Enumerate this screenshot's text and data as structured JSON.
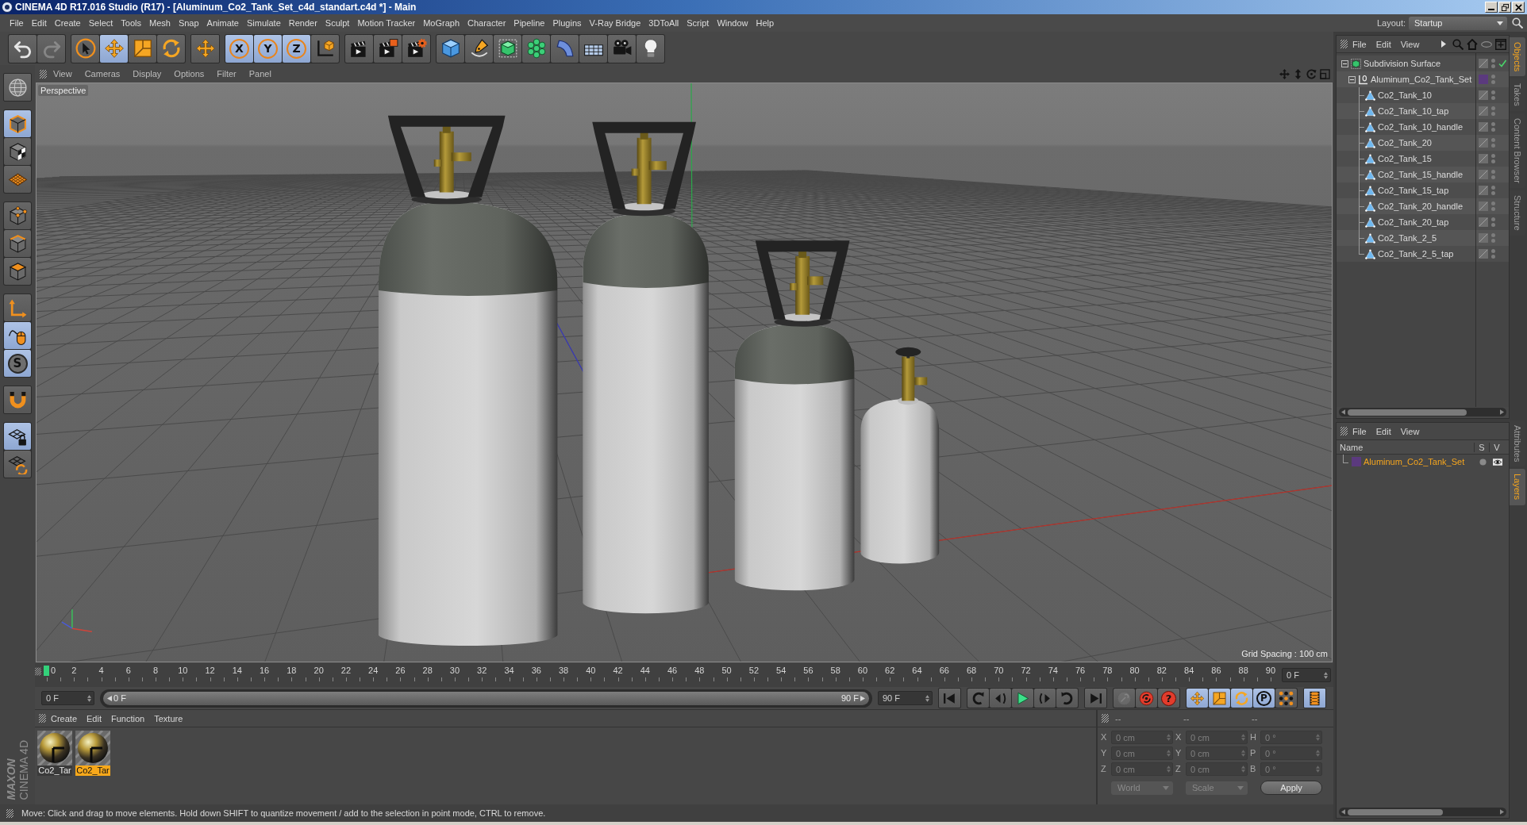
{
  "window": {
    "title": "CINEMA 4D R17.016 Studio (R17) - [Aluminum_Co2_Tank_Set_c4d_standart.c4d *] - Main",
    "controls": [
      {
        "kind": "minimize"
      },
      {
        "kind": "restore"
      },
      {
        "kind": "close"
      }
    ]
  },
  "menu_bar": {
    "items": [
      "File",
      "Edit",
      "Create",
      "Select",
      "Tools",
      "Mesh",
      "Snap",
      "Animate",
      "Simulate",
      "Render",
      "Sculpt",
      "Motion Tracker",
      "MoGraph",
      "Character",
      "Pipeline",
      "Plugins",
      "V-Ray Bridge",
      "3DToAll",
      "Script",
      "Window",
      "Help"
    ],
    "layout_label": "Layout:",
    "layout_value": "Startup"
  },
  "toolbar": {
    "groups": [
      [
        {
          "kind": "undo",
          "selected": false,
          "disabled": false
        },
        {
          "kind": "redo",
          "selected": false,
          "disabled": true
        }
      ],
      [
        {
          "kind": "live-select",
          "selected": false,
          "disabled": false
        },
        {
          "kind": "move",
          "selected": true,
          "disabled": false
        },
        {
          "kind": "scale",
          "selected": false,
          "disabled": false
        },
        {
          "kind": "rotate",
          "selected": false,
          "disabled": false
        }
      ],
      [
        {
          "kind": "move",
          "selected": false,
          "disabled": false
        }
      ],
      [
        {
          "kind": "axis-lock",
          "label": "X",
          "selected": true,
          "disabled": false
        },
        {
          "kind": "axis-lock",
          "label": "Y",
          "selected": true,
          "disabled": false
        },
        {
          "kind": "axis-lock",
          "label": "Z",
          "selected": true,
          "disabled": false
        },
        {
          "kind": "coordinate-system",
          "selected": false,
          "disabled": false
        }
      ],
      [
        {
          "kind": "render-view",
          "selected": false,
          "disabled": false
        },
        {
          "kind": "render-picture",
          "selected": false,
          "disabled": false
        },
        {
          "kind": "render-settings",
          "selected": false,
          "disabled": false
        }
      ],
      [
        {
          "kind": "cube",
          "selected": false,
          "disabled": false
        },
        {
          "kind": "pen",
          "selected": false,
          "disabled": false
        },
        {
          "kind": "subdivision",
          "selected": false,
          "disabled": false
        },
        {
          "kind": "cloner",
          "selected": false,
          "disabled": false
        },
        {
          "kind": "deformer",
          "selected": false,
          "disabled": false
        },
        {
          "kind": "floor",
          "selected": false,
          "disabled": false
        },
        {
          "kind": "camera",
          "selected": false,
          "disabled": false
        },
        {
          "kind": "light",
          "selected": false,
          "disabled": false
        }
      ]
    ]
  },
  "left_toolbar": {
    "groups": [
      [
        {
          "kind": "globe",
          "selected": false
        }
      ],
      [
        {
          "kind": "model",
          "selected": true
        },
        {
          "kind": "texture",
          "selected": false
        },
        {
          "kind": "workplane",
          "selected": false
        }
      ],
      [
        {
          "kind": "points",
          "selected": false
        },
        {
          "kind": "edges",
          "selected": false
        },
        {
          "kind": "polygons",
          "selected": false
        }
      ],
      [
        {
          "kind": "axis-mode",
          "selected": false
        },
        {
          "kind": "tweak",
          "selected": true
        },
        {
          "kind": "solo",
          "label": "S",
          "selected": true
        }
      ],
      [
        {
          "kind": "snap",
          "selected": false
        }
      ],
      [
        {
          "kind": "workplane-lock",
          "selected": true
        },
        {
          "kind": "planar-workplane",
          "selected": false
        }
      ]
    ],
    "logo": {
      "brand": "MAXON",
      "product": "CINEMA 4D"
    }
  },
  "viewport": {
    "menu": [
      "View",
      "Cameras",
      "Display",
      "Options",
      "Filter",
      "Panel"
    ],
    "camera": "Perspective",
    "grid_spacing": "Grid Spacing : 100 cm"
  },
  "timeline": {
    "ruler_labels": [
      "0",
      "2",
      "4",
      "6",
      "8",
      "10",
      "12",
      "14",
      "16",
      "18",
      "20",
      "22",
      "24",
      "26",
      "28",
      "30",
      "32",
      "34",
      "36",
      "38",
      "40",
      "42",
      "44",
      "46",
      "48",
      "50",
      "52",
      "54",
      "56",
      "58",
      "60",
      "62",
      "64",
      "66",
      "68",
      "70",
      "72",
      "74",
      "76",
      "78",
      "80",
      "82",
      "84",
      "86",
      "88",
      "90"
    ],
    "playhead": {
      "level": 0
    },
    "current_frame": "0 F"
  },
  "playback": {
    "start_frame": "0 F",
    "range_start": "0 F",
    "range_end": "90 F",
    "range": {
      "level": 1
    },
    "end_frame": "90 F",
    "groups": [
      [
        {
          "kind": "go-start",
          "selected": false,
          "disabled": false
        }
      ],
      [
        {
          "kind": "prev-key",
          "selected": false,
          "disabled": false
        },
        {
          "kind": "prev-frame",
          "selected": false,
          "disabled": false
        },
        {
          "kind": "play",
          "selected": false,
          "disabled": false
        },
        {
          "kind": "next-frame",
          "selected": false,
          "disabled": false
        },
        {
          "kind": "next-key",
          "selected": false,
          "disabled": false
        }
      ],
      [
        {
          "kind": "go-end",
          "selected": false,
          "disabled": false
        }
      ],
      [
        {
          "kind": "record-keys",
          "selected": false,
          "disabled": true
        },
        {
          "kind": "autokey",
          "selected": false,
          "disabled": false
        },
        {
          "kind": "keyframe-help",
          "label": "?",
          "selected": false,
          "disabled": false
        }
      ],
      [
        {
          "kind": "key-move",
          "selected": true,
          "disabled": false
        },
        {
          "kind": "key-scale",
          "selected": true,
          "disabled": false
        },
        {
          "kind": "key-rotate",
          "selected": true,
          "disabled": false
        },
        {
          "kind": "key-param",
          "label": "P",
          "selected": true,
          "disabled": false
        },
        {
          "kind": "key-pla",
          "selected": false,
          "disabled": false
        }
      ],
      [
        {
          "kind": "timeline",
          "selected": true,
          "disabled": false
        }
      ]
    ]
  },
  "materials": {
    "menu": [
      "Create",
      "Edit",
      "Function",
      "Texture"
    ],
    "items": [
      {
        "name": "Co2_Tar",
        "selected": false
      },
      {
        "name": "Co2_Tar",
        "selected": true
      }
    ]
  },
  "coordinates": {
    "headers": [
      "--",
      "--",
      "--"
    ],
    "rows": [
      [
        {
          "axis": "X",
          "value": "0 cm"
        },
        {
          "axis": "X",
          "value": "0 cm"
        },
        {
          "axis": "H",
          "value": "0 °"
        }
      ],
      [
        {
          "axis": "Y",
          "value": "0 cm"
        },
        {
          "axis": "Y",
          "value": "0 cm"
        },
        {
          "axis": "P",
          "value": "0 °"
        }
      ],
      [
        {
          "axis": "Z",
          "value": "0 cm"
        },
        {
          "axis": "Z",
          "value": "0 cm"
        },
        {
          "axis": "B",
          "value": "0 °"
        }
      ]
    ],
    "dropdowns": [
      "World",
      "Scale"
    ],
    "apply": "Apply"
  },
  "status_bar": "Move: Click and drag to move elements. Hold down SHIFT to quantize movement / add to the selection in point mode, CTRL to remove.",
  "object_manager": {
    "menu": [
      "File",
      "Edit",
      "View"
    ],
    "tree": [
      {
        "name": "Subdivision Surface",
        "kind": "subdivision",
        "expanded": true,
        "enabled": true,
        "children": [
          {
            "name": "Aluminum_Co2_Tank_Set",
            "kind": "null",
            "expanded": true,
            "color": "#5b3a7e",
            "children": [
              {
                "name": "Co2_Tank_10",
                "kind": "polygon"
              },
              {
                "name": "Co2_Tank_10_tap",
                "kind": "polygon"
              },
              {
                "name": "Co2_Tank_10_handle",
                "kind": "polygon"
              },
              {
                "name": "Co2_Tank_20",
                "kind": "polygon"
              },
              {
                "name": "Co2_Tank_15",
                "kind": "polygon"
              },
              {
                "name": "Co2_Tank_15_handle",
                "kind": "polygon"
              },
              {
                "name": "Co2_Tank_15_tap",
                "kind": "polygon"
              },
              {
                "name": "Co2_Tank_20_handle",
                "kind": "polygon"
              },
              {
                "name": "Co2_Tank_20_tap",
                "kind": "polygon"
              },
              {
                "name": "Co2_Tank_2_5",
                "kind": "polygon"
              },
              {
                "name": "Co2_Tank_2_5_tap",
                "kind": "polygon"
              }
            ]
          }
        ]
      }
    ]
  },
  "layer_manager": {
    "menu": [
      "File",
      "Edit",
      "View"
    ],
    "columns": [
      "Name",
      "S",
      "V"
    ],
    "layers": [
      {
        "name": "Aluminum_Co2_Tank_Set",
        "color": "#5b3a7e",
        "selected": true,
        "solo": false,
        "visible": true
      }
    ]
  },
  "side_tabs": {
    "upper": [
      {
        "label": "Objects",
        "selected": true
      },
      {
        "label": "Takes",
        "selected": false
      },
      {
        "label": "Content Browser",
        "selected": false
      },
      {
        "label": "Structure",
        "selected": false
      }
    ],
    "lower": [
      {
        "label": "Attributes",
        "selected": false
      },
      {
        "label": "Layers",
        "selected": true
      }
    ]
  }
}
